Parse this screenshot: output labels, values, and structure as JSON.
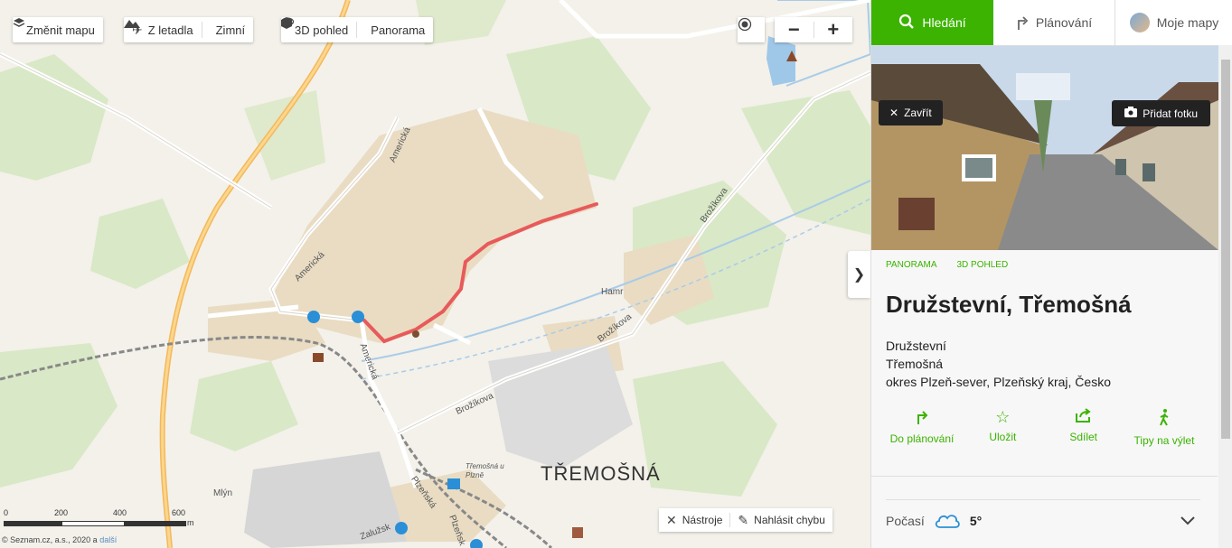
{
  "toolbar": {
    "change_map": "Změnit mapu",
    "aerial": "Z letadla",
    "winter": "Zimní",
    "view_3d": "3D pohled",
    "panorama": "Panorama"
  },
  "zoom": {
    "minus": "−",
    "plus": "+"
  },
  "map_labels": {
    "americka1": "Americká",
    "americka2": "Americká",
    "americka3": "Americká",
    "brozikova1": "Brožíkova",
    "brozikova2": "Brožíkova",
    "brozikova3": "Brožíkova",
    "hamr": "Hamr",
    "town": "TŘEMOŠNÁ",
    "station": "Třemošná u Plzně",
    "mlyn": "Mlýn",
    "plzenska1": "Plzeňská",
    "plzenska2": "Plzeňsk",
    "zaluzska": "Zalužsk"
  },
  "scale": {
    "t0": "0",
    "t200": "200",
    "t400": "400",
    "t600": "600",
    "unit": "m"
  },
  "copyright": {
    "text": "© Seznam.cz, a.s., 2020 a",
    "more": "další"
  },
  "bottom_tools": {
    "tools": "Nástroje",
    "report": "Nahlásit chybu"
  },
  "tabs": {
    "search": "Hledání",
    "planning": "Plánování",
    "my_maps": "Moje mapy"
  },
  "photo": {
    "close": "Zavřít",
    "add_photo": "Přidat fotku"
  },
  "links": {
    "panorama": "PANORAMA",
    "view_3d": "3D POHLED"
  },
  "place": {
    "title": "Družstevní, Třemošná",
    "line1": "Družstevní",
    "line2": "Třemošná",
    "line3": "okres Plzeň-sever, Plzeňský kraj, Česko"
  },
  "actions": {
    "plan": "Do plánování",
    "save": "Uložit",
    "share": "Sdílet",
    "trip": "Tipy na výlet"
  },
  "weather": {
    "label": "Počasí",
    "temp": "5°"
  },
  "colors": {
    "accent": "#3bb300",
    "route": "#e85a5a",
    "road_major": "#f4b85a"
  }
}
